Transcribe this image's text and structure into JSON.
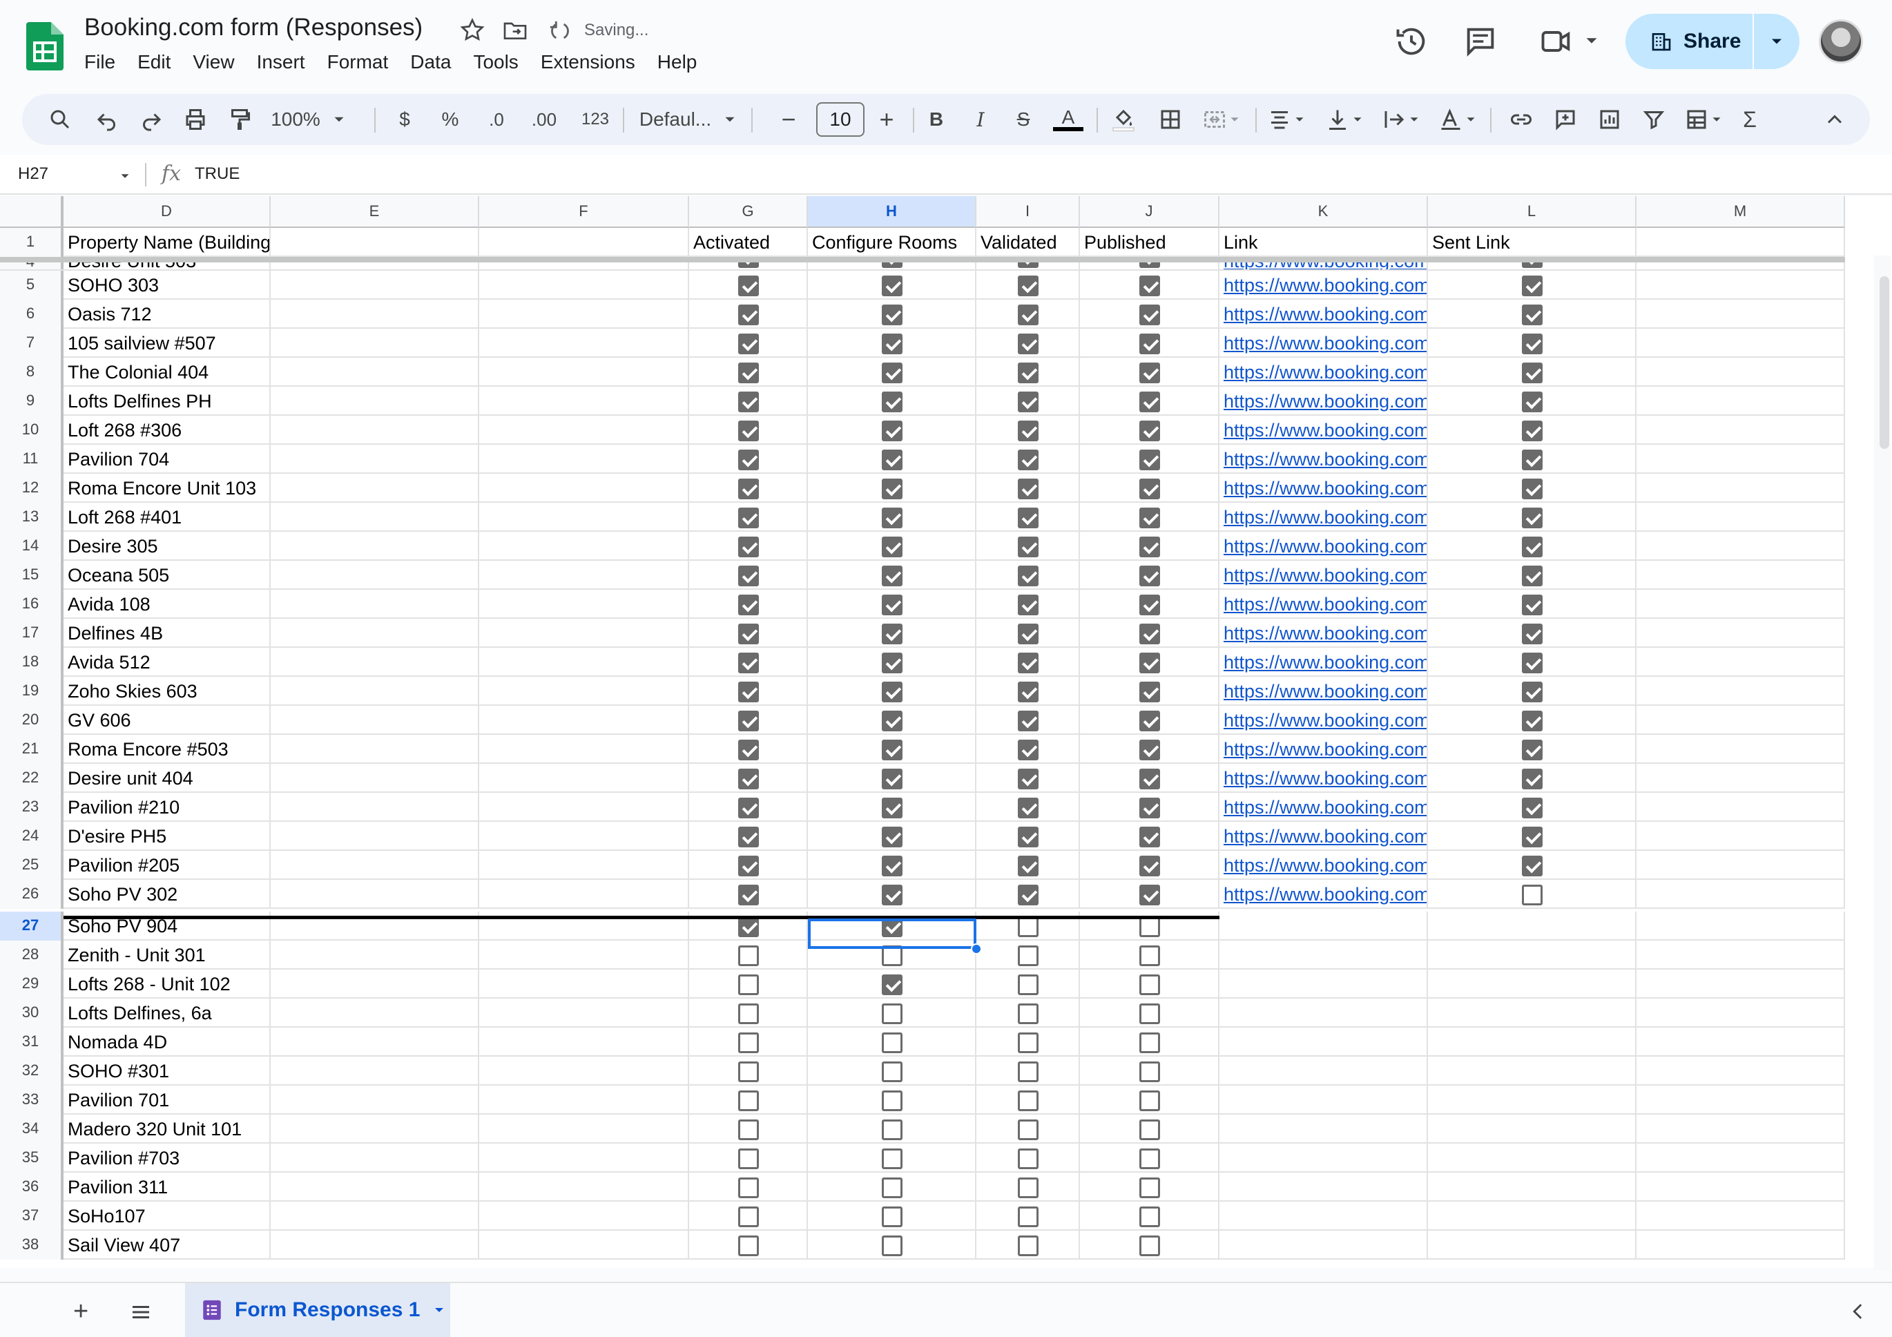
{
  "app": {
    "title": "Booking.com form (Responses)",
    "status": "Saving...",
    "menu": [
      "File",
      "Edit",
      "View",
      "Insert",
      "Format",
      "Data",
      "Tools",
      "Extensions",
      "Help"
    ],
    "share_label": "Share"
  },
  "toolbar": {
    "zoom": "100%",
    "currency": "$",
    "percent": "%",
    "decrease_decimal": ".0",
    "increase_decimal": ".00",
    "number_format": "123",
    "font": "Defaul...",
    "font_size": "10",
    "bold": "B",
    "italic": "I",
    "strikethrough": "S",
    "text_color": "A",
    "functions": "Σ"
  },
  "formula_bar": {
    "cell_ref": "H27",
    "fx": "fx",
    "value": "TRUE"
  },
  "grid": {
    "column_letters": [
      "D",
      "E",
      "F",
      "G",
      "H",
      "I",
      "J",
      "K",
      "L",
      "M"
    ],
    "selected_column": "H",
    "selected_row": "27",
    "header_row": {
      "num": "1",
      "D": "Property Name (Building and Unit #)",
      "G": "Activated",
      "H": "Configure Rooms",
      "I": "Validated",
      "J": "Published",
      "K": "Link",
      "L": "Sent Link"
    },
    "partial_row": {
      "num": "4",
      "name": "Desire Unit 503",
      "link": "https://www.booking.com"
    },
    "link_text": "https://www.booking.com",
    "rows": [
      {
        "num": "5",
        "name": "SOHO 303",
        "g": true,
        "h": true,
        "i": true,
        "j": true,
        "link": true,
        "l": true
      },
      {
        "num": "6",
        "name": "Oasis 712",
        "g": true,
        "h": true,
        "i": true,
        "j": true,
        "link": true,
        "l": true
      },
      {
        "num": "7",
        "name": "105 sailview #507",
        "g": true,
        "h": true,
        "i": true,
        "j": true,
        "link": true,
        "l": true
      },
      {
        "num": "8",
        "name": "The Colonial 404",
        "g": true,
        "h": true,
        "i": true,
        "j": true,
        "link": true,
        "l": true
      },
      {
        "num": "9",
        "name": "Lofts Delfines PH",
        "g": true,
        "h": true,
        "i": true,
        "j": true,
        "link": true,
        "l": true
      },
      {
        "num": "10",
        "name": "Loft 268  #306",
        "g": true,
        "h": true,
        "i": true,
        "j": true,
        "link": true,
        "l": true
      },
      {
        "num": "11",
        "name": "Pavilion 704",
        "g": true,
        "h": true,
        "i": true,
        "j": true,
        "link": true,
        "l": true
      },
      {
        "num": "12",
        "name": "Roma Encore Unit 103",
        "g": true,
        "h": true,
        "i": true,
        "j": true,
        "link": true,
        "l": true
      },
      {
        "num": "13",
        "name": "Loft 268 #401",
        "g": true,
        "h": true,
        "i": true,
        "j": true,
        "link": true,
        "l": true
      },
      {
        "num": "14",
        "name": "Desire 305",
        "g": true,
        "h": true,
        "i": true,
        "j": true,
        "link": true,
        "l": true
      },
      {
        "num": "15",
        "name": "Oceana 505",
        "g": true,
        "h": true,
        "i": true,
        "j": true,
        "link": true,
        "l": true
      },
      {
        "num": "16",
        "name": "Avida 108",
        "g": true,
        "h": true,
        "i": true,
        "j": true,
        "link": true,
        "l": true
      },
      {
        "num": "17",
        "name": "Delfines 4B",
        "g": true,
        "h": true,
        "i": true,
        "j": true,
        "link": true,
        "l": true
      },
      {
        "num": "18",
        "name": "Avida 512",
        "g": true,
        "h": true,
        "i": true,
        "j": true,
        "link": true,
        "l": true
      },
      {
        "num": "19",
        "name": "Zoho Skies 603",
        "g": true,
        "h": true,
        "i": true,
        "j": true,
        "link": true,
        "l": true
      },
      {
        "num": "20",
        "name": "GV 606",
        "g": true,
        "h": true,
        "i": true,
        "j": true,
        "link": true,
        "l": true
      },
      {
        "num": "21",
        "name": "Roma Encore #503",
        "g": true,
        "h": true,
        "i": true,
        "j": true,
        "link": true,
        "l": true
      },
      {
        "num": "22",
        "name": "Desire unit 404",
        "g": true,
        "h": true,
        "i": true,
        "j": true,
        "link": true,
        "l": true
      },
      {
        "num": "23",
        "name": "Pavilion #210",
        "g": true,
        "h": true,
        "i": true,
        "j": true,
        "link": true,
        "l": true
      },
      {
        "num": "24",
        "name": "D'esire PH5",
        "g": true,
        "h": true,
        "i": true,
        "j": true,
        "link": true,
        "l": true
      },
      {
        "num": "25",
        "name": "Pavilion #205",
        "g": true,
        "h": true,
        "i": true,
        "j": true,
        "link": true,
        "l": true
      },
      {
        "num": "26",
        "name": "Soho PV 302",
        "g": true,
        "h": true,
        "i": true,
        "j": true,
        "link": true,
        "l": false
      },
      {
        "num": "27",
        "name": "Soho PV 904",
        "g": true,
        "h": true,
        "i": false,
        "j": false,
        "link": false,
        "l": null
      },
      {
        "num": "28",
        "name": "Zenith - Unit 301",
        "g": false,
        "h": false,
        "i": false,
        "j": false,
        "link": false,
        "l": null
      },
      {
        "num": "29",
        "name": "Lofts 268 - Unit 102",
        "g": false,
        "h": true,
        "i": false,
        "j": false,
        "link": false,
        "l": null
      },
      {
        "num": "30",
        "name": "Lofts Delfines, 6a",
        "g": false,
        "h": false,
        "i": false,
        "j": false,
        "link": false,
        "l": null
      },
      {
        "num": "31",
        "name": "Nomada 4D",
        "g": false,
        "h": false,
        "i": false,
        "j": false,
        "link": false,
        "l": null
      },
      {
        "num": "32",
        "name": "SOHO #301",
        "g": false,
        "h": false,
        "i": false,
        "j": false,
        "link": false,
        "l": null
      },
      {
        "num": "33",
        "name": "Pavilion 701",
        "g": false,
        "h": false,
        "i": false,
        "j": false,
        "link": false,
        "l": null
      },
      {
        "num": "34",
        "name": "Madero 320 Unit 101",
        "g": false,
        "h": false,
        "i": false,
        "j": false,
        "link": false,
        "l": null
      },
      {
        "num": "35",
        "name": "Pavilion #703",
        "g": false,
        "h": false,
        "i": false,
        "j": false,
        "link": false,
        "l": null
      },
      {
        "num": "36",
        "name": "Pavilion 311",
        "g": false,
        "h": false,
        "i": false,
        "j": false,
        "link": false,
        "l": null
      },
      {
        "num": "37",
        "name": "SoHo107",
        "g": false,
        "h": false,
        "i": false,
        "j": false,
        "link": false,
        "l": null
      },
      {
        "num": "38",
        "name": "Sail View 407",
        "g": false,
        "h": false,
        "i": false,
        "j": false,
        "link": false,
        "l": null
      }
    ]
  },
  "sheets": {
    "add_icon": "+",
    "active_tab": "Form Responses 1"
  },
  "colors": {
    "accent": "#0b57d0",
    "share_bg": "#c2e7ff",
    "link": "#1155cc",
    "selection": "#1a73e8",
    "sheets_green": "#0f9d58",
    "forms_purple": "#7248b9"
  },
  "icons": [
    "sheets-logo-icon",
    "star-icon",
    "move-folder-icon",
    "sync-icon",
    "history-icon",
    "comment-icon",
    "meet-icon",
    "building-icon",
    "chevron-down-icon",
    "search-icon",
    "undo-icon",
    "redo-icon",
    "print-icon",
    "paint-format-icon",
    "fill-color-icon",
    "borders-icon",
    "merge-icon",
    "align-icon",
    "valign-icon",
    "wrap-icon",
    "rotate-icon",
    "link-icon",
    "add-comment-icon",
    "chart-icon",
    "filter-icon",
    "table-icon",
    "collapse-icon",
    "forms-icon"
  ]
}
